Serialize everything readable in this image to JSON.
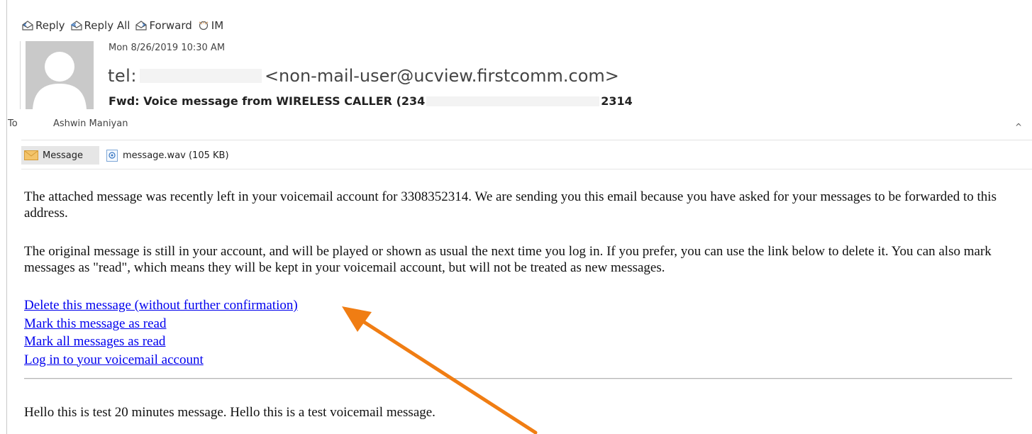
{
  "toolbar": {
    "reply": "Reply",
    "reply_all": "Reply All",
    "forward": "Forward",
    "im": "IM"
  },
  "header": {
    "date": "Mon 8/26/2019 10:30 AM",
    "sender_prefix": "tel:",
    "sender_email": "<non-mail-user@ucview.firstcomm.com>",
    "subject_start": "Fwd: Voice message from WIRELESS CALLER (234",
    "subject_end": "2314",
    "to_label": "To",
    "to_name": "Ashwin Maniyan"
  },
  "attachments": {
    "message_tab": "Message",
    "file": "message.wav (105 KB)"
  },
  "body": {
    "paragraph1": "The attached message was recently left in your voicemail account for 3308352314. We are sending you this email because you have asked for your messages to be forwarded to this address.",
    "paragraph2": "The original message is still in your account, and will be played or shown as usual the next time you log in. If you prefer, you can use the link below to delete it. You can also mark messages as \"read\", which means they will be kept in your voicemail account, but will not be treated as new messages.",
    "links": [
      "Delete this message (without further confirmation)",
      "Mark this message as read",
      "Mark all messages as read",
      "Log in to your voicemail account"
    ],
    "transcript": "Hello this is test 20 minutes message. Hello this is a test voicemail message."
  },
  "colors": {
    "link": "#0000ee",
    "annotation_arrow": "#f07d13"
  }
}
